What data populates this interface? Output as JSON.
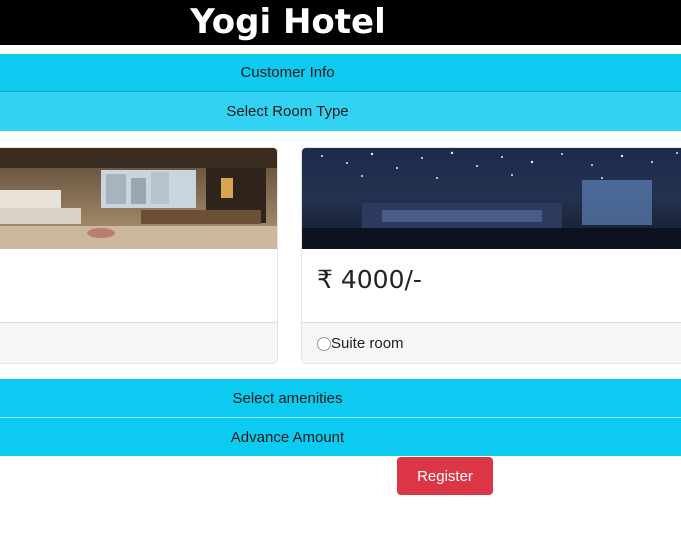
{
  "header": {
    "title": "Yogi Hotel"
  },
  "accordion": {
    "customer_info": "Customer Info",
    "select_room_type": "Select Room Type",
    "select_amenities": "Select amenities",
    "advance_amount": "Advance Amount"
  },
  "rooms": [
    {
      "name": "",
      "price": "",
      "image": "hotel-room-photo"
    },
    {
      "name": "Suite room",
      "price": "₹ 4000/-",
      "image": "suite-room-photo"
    }
  ],
  "register_label": "Register",
  "colors": {
    "accordion": "#0dcaf0",
    "register": "#dc3545",
    "header": "#000000"
  }
}
